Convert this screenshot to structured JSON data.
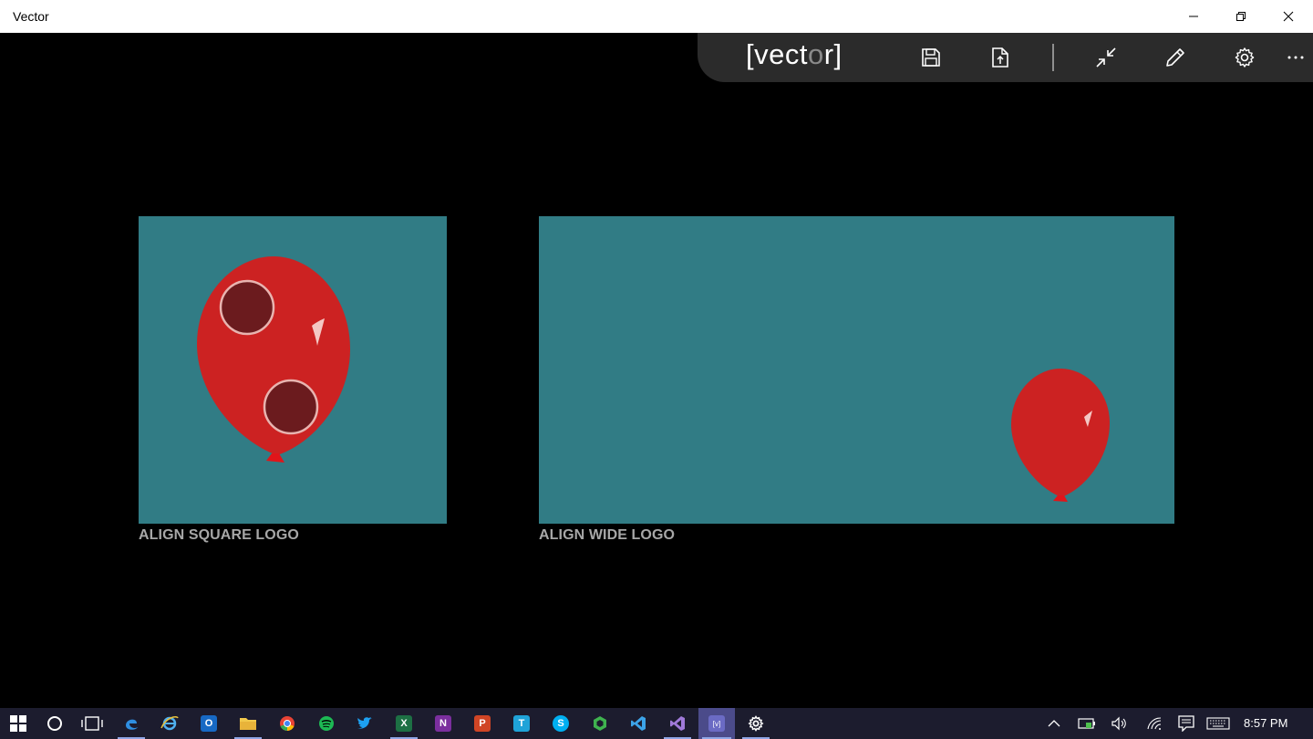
{
  "window": {
    "title": "Vector",
    "controls": [
      "minimize",
      "restore",
      "close"
    ]
  },
  "command_bar": {
    "brand": {
      "prefix": "[vect",
      "dim": "o",
      "suffix": "r]"
    },
    "buttons": [
      {
        "name": "save",
        "icon": "floppy-disk-icon"
      },
      {
        "name": "export",
        "icon": "document-export-icon"
      },
      {
        "name": "collapse",
        "icon": "collapse-arrows-icon"
      },
      {
        "name": "edit",
        "icon": "pencil-icon"
      },
      {
        "name": "settings",
        "icon": "gear-icon"
      },
      {
        "name": "more",
        "icon": "more-dots-icon"
      }
    ]
  },
  "tiles": {
    "square": {
      "label": "ALIGN SQUARE LOGO",
      "background": "#317c85"
    },
    "wide": {
      "label": "ALIGN WIDE LOGO",
      "background": "#317c85"
    }
  },
  "colors": {
    "balloon": "#cc2222",
    "balloon_hole": "#6b1b1e",
    "tile": "#317c85",
    "label": "#a7a7a7"
  },
  "taskbar": {
    "apps": [
      {
        "name": "start",
        "icon": "windows-logo-icon"
      },
      {
        "name": "cortana",
        "icon": "cortana-circle-icon"
      },
      {
        "name": "task-view",
        "icon": "task-view-icon"
      },
      {
        "name": "edge",
        "icon": "edge-icon",
        "active": true
      },
      {
        "name": "internet-explorer",
        "icon": "ie-icon"
      },
      {
        "name": "outlook",
        "icon": "outlook-icon",
        "glyph": "O"
      },
      {
        "name": "file-explorer",
        "icon": "folder-icon",
        "active": true
      },
      {
        "name": "chrome",
        "icon": "chrome-icon"
      },
      {
        "name": "spotify",
        "icon": "spotify-icon"
      },
      {
        "name": "twitter",
        "icon": "twitter-icon"
      },
      {
        "name": "excel",
        "icon": "excel-icon",
        "glyph": "X",
        "active": true
      },
      {
        "name": "onenote",
        "icon": "onenote-icon",
        "glyph": "N"
      },
      {
        "name": "powerpoint",
        "icon": "powerpoint-icon",
        "glyph": "P"
      },
      {
        "name": "app-t",
        "icon": "t-app-icon",
        "glyph": "T"
      },
      {
        "name": "skype",
        "icon": "skype-icon",
        "glyph": "S"
      },
      {
        "name": "app-hex",
        "icon": "hexagon-app-icon"
      },
      {
        "name": "vs-code",
        "icon": "vs-code-icon"
      },
      {
        "name": "visual-studio",
        "icon": "visual-studio-icon",
        "active": true
      },
      {
        "name": "vector",
        "icon": "vector-app-icon",
        "glyph": "[v]",
        "focused": true,
        "active": true
      },
      {
        "name": "settings",
        "icon": "settings-gear-icon",
        "active": true
      }
    ],
    "tray": {
      "icons": [
        "chevron-up-icon",
        "battery-icon",
        "volume-icon",
        "wifi-icon",
        "action-center-icon",
        "keyboard-icon"
      ],
      "time": "8:57 PM"
    }
  }
}
